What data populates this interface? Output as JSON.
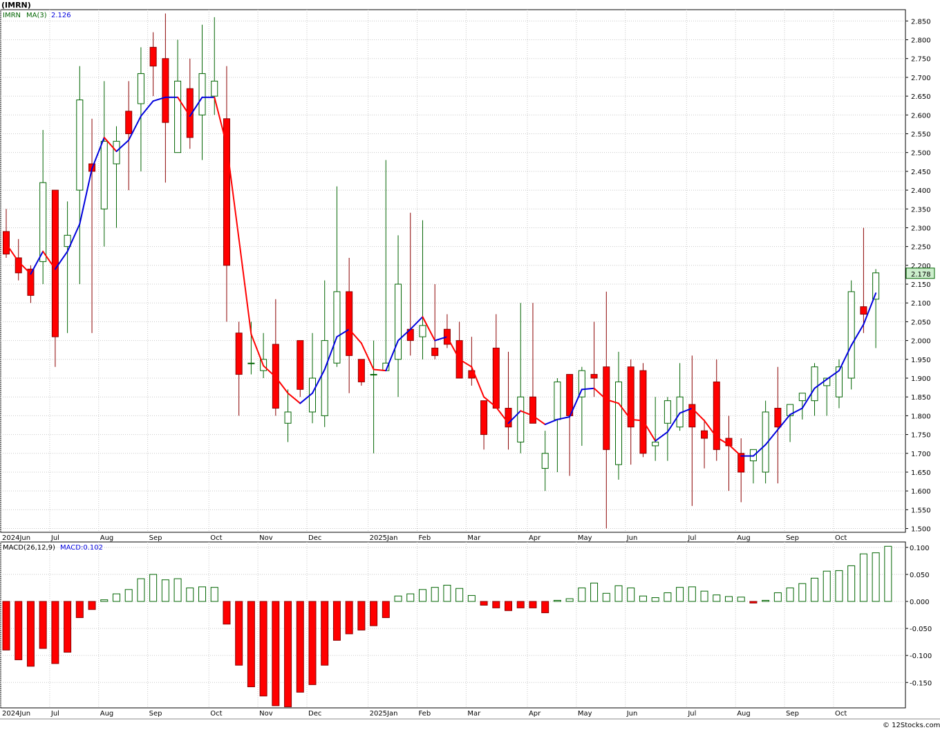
{
  "ticker_title": "(IMRN)",
  "footer": "© 12Stocks.com",
  "colors": {
    "up": "#ffffff",
    "up_border": "#006400",
    "down": "#ff0000",
    "down_border": "#8b0000",
    "ma_up": "#0000dd",
    "ma_down": "#ff0000",
    "grid": "#c8c8c8",
    "axis": "#000000",
    "panel_bg": "#ffffff",
    "last_badge": "#cceecc"
  },
  "price_panel": {
    "legend_ticker": "IMRN",
    "legend_ma": "MA(3)",
    "legend_ma_value": "2.126",
    "last_price_label": "2.178",
    "ylim": [
      1.49,
      2.88
    ],
    "yticks": [
      "1.500",
      "1.550",
      "1.600",
      "1.650",
      "1.700",
      "1.750",
      "1.800",
      "1.850",
      "1.900",
      "1.950",
      "2.000",
      "2.050",
      "2.100",
      "2.150",
      "2.200",
      "2.250",
      "2.300",
      "2.350",
      "2.400",
      "2.450",
      "2.500",
      "2.550",
      "2.600",
      "2.650",
      "2.700",
      "2.750",
      "2.800",
      "2.850"
    ]
  },
  "macd_panel": {
    "legend_title": "MACD(26,12,9)",
    "legend_value": "MACD:0.102",
    "ylim": [
      -0.197,
      0.11
    ],
    "yticks": [
      "0.100",
      "0.050",
      "0.000",
      "-0.050",
      "-0.100",
      "-0.150"
    ]
  },
  "x_axis": {
    "month_labels": [
      {
        "i": 0,
        "label": "2024Jun"
      },
      {
        "i": 4,
        "label": "Jul"
      },
      {
        "i": 8,
        "label": "Aug"
      },
      {
        "i": 12,
        "label": "Sep"
      },
      {
        "i": 17,
        "label": "Oct"
      },
      {
        "i": 21,
        "label": "Nov"
      },
      {
        "i": 25,
        "label": "Dec"
      },
      {
        "i": 30,
        "label": "2025Jan"
      },
      {
        "i": 34,
        "label": "Feb"
      },
      {
        "i": 38,
        "label": "Mar"
      },
      {
        "i": 43,
        "label": "Apr"
      },
      {
        "i": 47,
        "label": "May"
      },
      {
        "i": 51,
        "label": "Jun"
      },
      {
        "i": 56,
        "label": "Jul"
      },
      {
        "i": 60,
        "label": "Aug"
      },
      {
        "i": 64,
        "label": "Sep"
      },
      {
        "i": 68,
        "label": "Oct"
      }
    ]
  },
  "chart_data": {
    "type": "candlestick",
    "title": "(IMRN)",
    "ylim": [
      1.49,
      2.88
    ],
    "candles": [
      [
        2.29,
        2.35,
        2.22,
        2.23
      ],
      [
        2.22,
        2.27,
        2.16,
        2.18
      ],
      [
        2.19,
        2.2,
        2.1,
        2.12
      ],
      [
        2.21,
        2.56,
        2.15,
        2.42
      ],
      [
        2.4,
        2.4,
        1.93,
        2.01
      ],
      [
        2.25,
        2.37,
        2.02,
        2.28
      ],
      [
        2.4,
        2.73,
        2.15,
        2.64
      ],
      [
        2.47,
        2.59,
        2.02,
        2.45
      ],
      [
        2.35,
        2.69,
        2.25,
        2.53
      ],
      [
        2.47,
        2.57,
        2.3,
        2.53
      ],
      [
        2.61,
        2.69,
        2.4,
        2.55
      ],
      [
        2.63,
        2.78,
        2.45,
        2.71
      ],
      [
        2.78,
        2.82,
        2.65,
        2.73
      ],
      [
        2.75,
        2.87,
        2.42,
        2.58
      ],
      [
        2.5,
        2.8,
        2.5,
        2.69
      ],
      [
        2.67,
        2.75,
        2.51,
        2.54
      ],
      [
        2.6,
        2.84,
        2.48,
        2.71
      ],
      [
        2.65,
        2.86,
        2.6,
        2.69
      ],
      [
        2.59,
        2.73,
        2.05,
        2.2
      ],
      [
        2.02,
        2.05,
        1.8,
        1.91
      ],
      [
        1.94,
        2.05,
        1.91,
        1.94
      ],
      [
        1.92,
        2.02,
        1.9,
        1.95
      ],
      [
        1.99,
        2.11,
        1.8,
        1.82
      ],
      [
        1.78,
        1.87,
        1.73,
        1.81
      ],
      [
        2.0,
        2.0,
        1.85,
        1.87
      ],
      [
        1.81,
        2.02,
        1.78,
        1.9
      ],
      [
        1.8,
        2.16,
        1.77,
        2.0
      ],
      [
        1.94,
        2.41,
        1.93,
        2.13
      ],
      [
        2.13,
        2.22,
        1.86,
        1.96
      ],
      [
        1.95,
        1.95,
        1.88,
        1.89
      ],
      [
        1.91,
        2.0,
        1.7,
        1.91
      ],
      [
        1.92,
        2.48,
        1.92,
        1.94
      ],
      [
        1.95,
        2.28,
        1.85,
        2.15
      ],
      [
        2.03,
        2.34,
        1.96,
        2.0
      ],
      [
        2.01,
        2.32,
        1.95,
        2.04
      ],
      [
        1.98,
        2.15,
        1.95,
        1.96
      ],
      [
        2.03,
        2.07,
        1.98,
        1.99
      ],
      [
        2.0,
        2.05,
        1.91,
        1.9
      ],
      [
        1.92,
        2.01,
        1.88,
        1.9
      ],
      [
        1.84,
        1.84,
        1.71,
        1.75
      ],
      [
        1.98,
        2.07,
        1.82,
        1.82
      ],
      [
        1.82,
        1.97,
        1.71,
        1.77
      ],
      [
        1.73,
        2.1,
        1.7,
        1.85
      ],
      [
        1.85,
        2.1,
        1.78,
        1.78
      ],
      [
        1.66,
        1.76,
        1.6,
        1.7
      ],
      [
        1.79,
        1.9,
        1.65,
        1.89
      ],
      [
        1.91,
        1.91,
        1.64,
        1.8
      ],
      [
        1.85,
        1.93,
        1.72,
        1.92
      ],
      [
        1.91,
        2.05,
        1.85,
        1.9
      ],
      [
        1.93,
        2.13,
        1.5,
        1.71
      ],
      [
        1.67,
        1.97,
        1.63,
        1.89
      ],
      [
        1.93,
        1.95,
        1.67,
        1.77
      ],
      [
        1.92,
        1.94,
        1.69,
        1.7
      ],
      [
        1.72,
        1.85,
        1.68,
        1.73
      ],
      [
        1.78,
        1.85,
        1.68,
        1.84
      ],
      [
        1.77,
        1.94,
        1.76,
        1.85
      ],
      [
        1.83,
        1.96,
        1.56,
        1.77
      ],
      [
        1.76,
        1.79,
        1.66,
        1.74
      ],
      [
        1.89,
        1.95,
        1.68,
        1.71
      ],
      [
        1.74,
        1.8,
        1.6,
        1.72
      ],
      [
        1.7,
        1.74,
        1.57,
        1.65
      ],
      [
        1.68,
        1.71,
        1.62,
        1.71
      ],
      [
        1.65,
        1.84,
        1.62,
        1.81
      ],
      [
        1.82,
        1.93,
        1.62,
        1.77
      ],
      [
        1.8,
        1.83,
        1.73,
        1.83
      ],
      [
        1.84,
        1.86,
        1.79,
        1.86
      ],
      [
        1.84,
        1.94,
        1.8,
        1.93
      ],
      [
        1.88,
        1.89,
        1.8,
        1.9
      ],
      [
        1.85,
        1.95,
        1.82,
        1.93
      ],
      [
        1.9,
        2.16,
        1.87,
        2.13
      ],
      [
        2.09,
        2.3,
        2.02,
        2.07
      ],
      [
        2.11,
        2.19,
        1.98,
        2.18
      ]
    ],
    "ma3": [
      2.257,
      2.21,
      2.177,
      2.237,
      2.19,
      2.237,
      2.31,
      2.457,
      2.54,
      2.503,
      2.533,
      2.597,
      2.637,
      2.647,
      2.647,
      2.597,
      2.647,
      2.647,
      2.52,
      2.27,
      2.017,
      1.933,
      1.903,
      1.86,
      1.833,
      1.86,
      1.923,
      2.01,
      2.03,
      1.993,
      1.923,
      1.92,
      2.0,
      2.03,
      2.063,
      2.0,
      2.01,
      1.95,
      1.93,
      1.85,
      1.823,
      1.78,
      1.813,
      1.8,
      1.777,
      1.79,
      1.797,
      1.87,
      1.873,
      1.843,
      1.833,
      1.79,
      1.787,
      1.733,
      1.757,
      1.807,
      1.82,
      1.787,
      1.743,
      1.723,
      1.693,
      1.693,
      1.723,
      1.763,
      1.803,
      1.82,
      1.873,
      1.897,
      1.92,
      1.987,
      2.043,
      2.126
    ],
    "macd": [
      -0.09,
      -0.108,
      -0.12,
      -0.087,
      -0.115,
      -0.094,
      -0.03,
      -0.015,
      0.003,
      0.014,
      0.022,
      0.042,
      0.05,
      0.04,
      0.042,
      0.025,
      0.027,
      0.026,
      -0.042,
      -0.118,
      -0.158,
      -0.175,
      -0.193,
      -0.195,
      -0.168,
      -0.154,
      -0.118,
      -0.072,
      -0.06,
      -0.053,
      -0.045,
      -0.03,
      0.01,
      0.014,
      0.022,
      0.026,
      0.03,
      0.024,
      0.011,
      -0.007,
      -0.012,
      -0.017,
      -0.012,
      -0.012,
      -0.021,
      0.002,
      0.005,
      0.025,
      0.034,
      0.015,
      0.029,
      0.025,
      0.01,
      0.007,
      0.016,
      0.026,
      0.027,
      0.019,
      0.012,
      0.009,
      0.008,
      -0.003,
      0.002,
      0.016,
      0.025,
      0.033,
      0.043,
      0.056,
      0.057,
      0.066,
      0.088,
      0.09,
      0.102
    ]
  }
}
